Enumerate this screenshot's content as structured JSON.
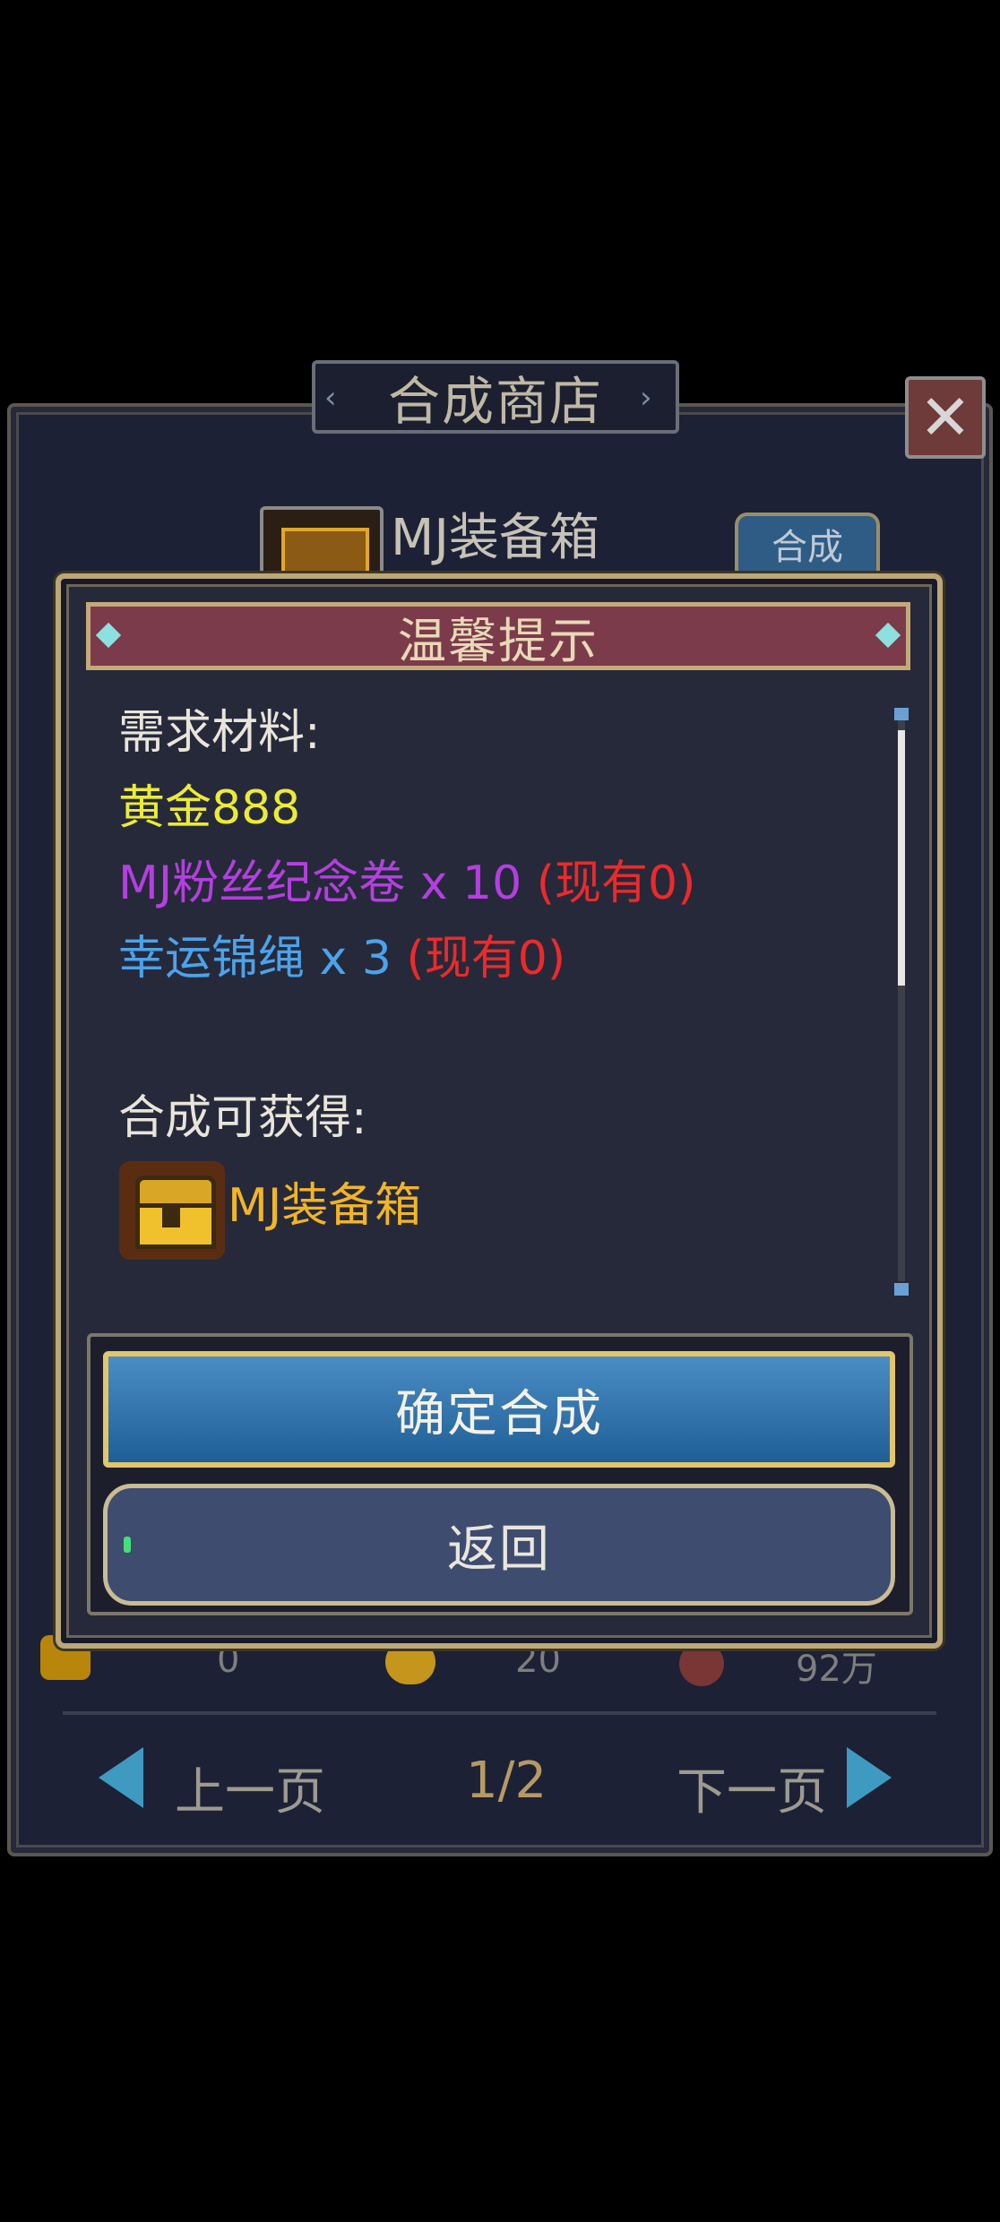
{
  "shop": {
    "title": "合成商店",
    "item_name": "MJ装备箱",
    "compose_label": "合成",
    "currencies": [
      "0",
      "20",
      "92万"
    ],
    "prev_label": "上一页",
    "page": "1/2",
    "next_label": "下一页"
  },
  "dialog": {
    "title": "温馨提示",
    "required_label": "需求材料:",
    "requirements": [
      {
        "name": "黄金888",
        "color": "#ecec32",
        "have": ""
      },
      {
        "name": "MJ粉丝纪念卷 x 10",
        "color": "#b43fe0",
        "have": "(现有0)"
      },
      {
        "name": "幸运锦绳 x 3",
        "color": "#4ba3ea",
        "have": "(现有0)"
      }
    ],
    "obtain_label": "合成可获得:",
    "reward_name": "MJ装备箱",
    "reward_color": "#f2b524",
    "have_color": "#ec2a2a",
    "confirm_label": "确定合成",
    "back_label": "返回"
  },
  "icons": {
    "close": "close-icon",
    "chest": "treasure-chest-icon",
    "arrow_left": "arrow-left-icon",
    "arrow_right": "arrow-right-icon"
  }
}
